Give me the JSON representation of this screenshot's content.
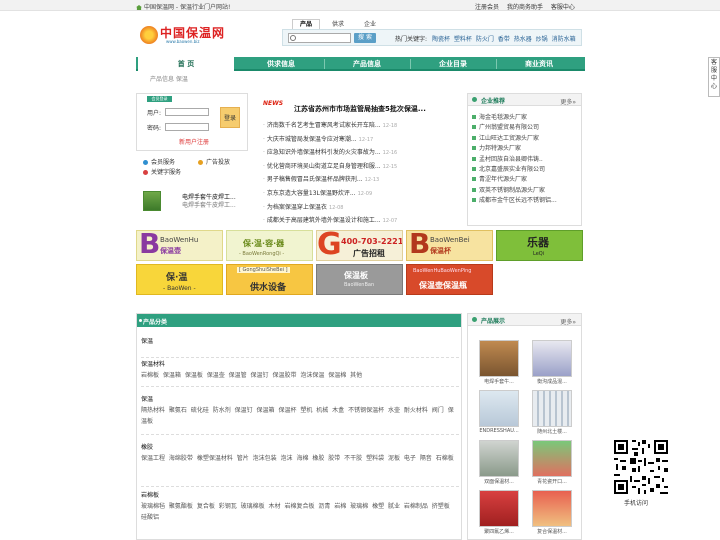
{
  "topbar": {
    "home_text": "中国保温网 - 保温行业门户网站!",
    "links": [
      "注册会员",
      "我的商务助手",
      "客服中心"
    ]
  },
  "logo": {
    "name": "中国保温网",
    "url": "www.baowen.biz"
  },
  "search": {
    "tabs": [
      "产品",
      "供求",
      "企业"
    ],
    "active_tab": "产品",
    "input_value": "",
    "button": "搜 索",
    "hot_label": "热门关键字:",
    "hot_words": [
      "陶瓷杯",
      "塑料杯",
      "防火门",
      "香带",
      "热水器",
      "炒锅",
      "消防水箱"
    ]
  },
  "nav": {
    "items": [
      "首 页",
      "供求信息",
      "产品信息",
      "企业目录",
      "商业资讯"
    ],
    "active": 0
  },
  "breadcrumb": "产品信息  保温",
  "side_tab": "客服中心",
  "login": {
    "header": "会员登录",
    "user_label": "用户:",
    "pass_label": "密码:",
    "button": "登录",
    "register": "新用户注册"
  },
  "services": [
    "会员服务",
    "广告投放",
    "关键字服务"
  ],
  "ad_small": {
    "title": "电焊手套牛皮焊工...",
    "subtitle": "电焊手套牛皮焊工..."
  },
  "news": {
    "badge": "NEWS",
    "headline": "江苏省苏州市市场监管局抽查5批次保温...",
    "items": [
      {
        "title": "济南数千名艺考生冒寒风考试家长开车陪...",
        "date": "12-18"
      },
      {
        "title": "大庆市城管局发保温令应对寒潮...",
        "date": "12-17"
      },
      {
        "title": "应急知识外墙保温材料引发的火灾事故为...",
        "date": "12-16"
      },
      {
        "title": "优化营商环境吴山街道立足自身管理和服...",
        "date": "12-15"
      },
      {
        "title": "男子稿售假冒吕氏保温杯品牌获刑...",
        "date": "12-13"
      },
      {
        "title": "京东京造大容量13L保温野炊评...",
        "date": "12-09"
      },
      {
        "title": "为档案保温穿上保温衣",
        "date": "12-08"
      },
      {
        "title": "成都关于高层建筑外墙外保温设计和施工...",
        "date": "12-07"
      }
    ]
  },
  "company": {
    "title": "企业推荐",
    "more": "更多»",
    "items": [
      "海金毛毯源头厂家",
      "广州翁盟贸易有限公司",
      "江山旺达工贸源头厂家",
      "力邦特源头厂家",
      "孟村回族自治县卿伟铸..",
      "北京嘉盛辰实业有限公司",
      "青涩年代源头厂家",
      "双英不锈钢制品源头厂家",
      "成都市金牛区长远不锈钢铝..."
    ]
  },
  "banners": [
    {
      "big": "BaoWenHu",
      "sm": "保温壶"
    },
    {
      "big": "保·温·容·器",
      "sm": "- BaoWenRongQi -"
    },
    {
      "big": "400-703-2221",
      "sm": "广告招租"
    },
    {
      "big": "BaoWenBei",
      "sm": "保温杯"
    },
    {
      "big": "乐器",
      "sm": "LeQi"
    },
    {
      "big": "保·温",
      "sm": "- BaoWen -"
    },
    {
      "big": "供水设备",
      "sm": "[ GongShuiSheBei ]"
    },
    {
      "big": "保温板",
      "sm": "BaoWenBan"
    },
    {
      "big": "保温壶保温瓶",
      "sm": "BaoWenHuBaoWenPing"
    }
  ],
  "categories": {
    "title": "产品分类",
    "groups": [
      {
        "name": "保温",
        "items": ""
      },
      {
        "name": "保温材料",
        "items": "岩棉板 保温箱 保温板 保温壶 保温管 保温钉 保温胶带 泡沫保温 保温棉 其他"
      },
      {
        "name": "保温",
        "items": "隔热材料 聚氨石 硫化硅 防水剂 保温钉 保温箱 保温杯 塑机 机械 木盒 不锈钢保温杯 水壶 耐火材料 阀门 保温板"
      },
      {
        "name": "橡胶",
        "items": "保温工程 海绵胶带 橡塑保温材料 管片 泡沫包装 泡沫 海棉 橡胶 胶带 不干胶 塑料袋 泥板 电子 隔音 石棉板"
      },
      {
        "name": "岩棉板",
        "items": "玻璃棉毡 聚氨酯板 复合板 彩钢瓦 玻璃棉板 木材 岩棉复合板 沥青 岩棉 玻璃棉 橡塑 腻业 岩棉制品 挤塑板 硅酸铝"
      }
    ]
  },
  "products": {
    "title": "产品展示",
    "more": "更多»",
    "items": [
      {
        "caption": "电焊手套牛..."
      },
      {
        "caption": "衡沟成品混..."
      },
      {
        "caption": "ENDRESSHAU..."
      },
      {
        "caption": "随州北土楼..."
      },
      {
        "caption": "双面保温材..."
      },
      {
        "caption": "青花瓷开口..."
      },
      {
        "caption": "聚四氟乙烯..."
      },
      {
        "caption": "复合保温材..."
      }
    ]
  },
  "qr": {
    "caption": "手机访问"
  }
}
